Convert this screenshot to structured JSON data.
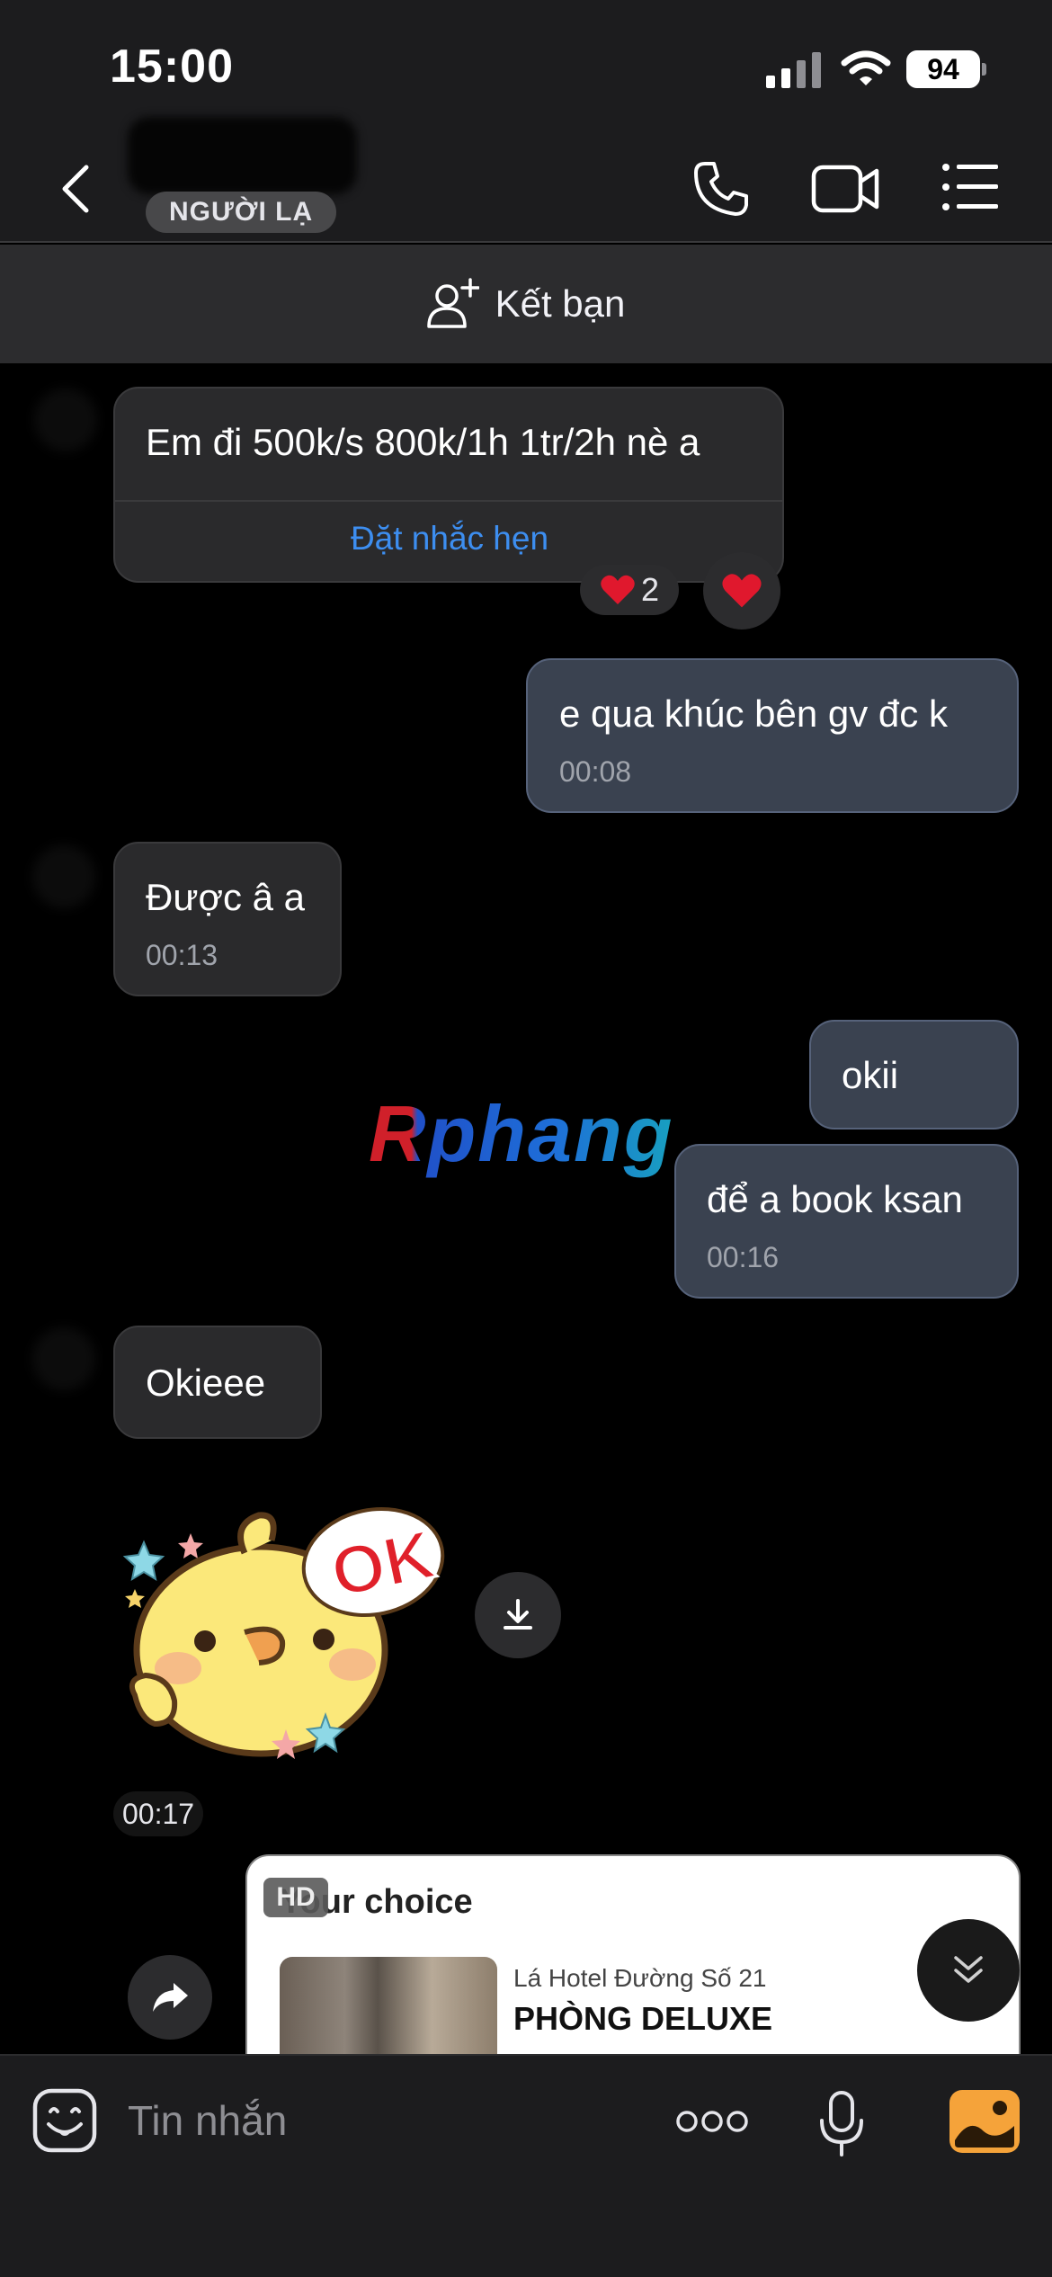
{
  "status_bar": {
    "time": "15:00",
    "battery": "94"
  },
  "header": {
    "stranger_badge": "NGƯỜI LẠ"
  },
  "add_friend": {
    "label": "Kết bạn"
  },
  "messages": [
    {
      "direction": "in",
      "text": "Em đi 500k/s 800k/1h 1tr/2h nè a",
      "action": "Đặt nhắc hẹn",
      "reactions": {
        "emoji": "heart",
        "count": "2"
      }
    },
    {
      "direction": "out",
      "text": "e qua khúc bên gv đc k",
      "time": "00:08"
    },
    {
      "direction": "in",
      "text": "Được â a",
      "time": "00:13"
    },
    {
      "direction": "out",
      "text": "okii"
    },
    {
      "direction": "out",
      "text": "để a book ksan",
      "time": "00:16"
    },
    {
      "direction": "in",
      "text": "Okieee"
    },
    {
      "direction": "in",
      "type": "sticker",
      "sticker_text": "OK",
      "time": "00:17"
    }
  ],
  "watermark": "Rphang",
  "hotel_card": {
    "badge": "HD",
    "title": "Your choice",
    "hotel_name": "Lá Hotel Đường Số 21",
    "room_type": "PHÒNG DELUXE"
  },
  "composer": {
    "placeholder": "Tin nhắn"
  },
  "colors": {
    "incoming_bubble": "#2a2a2c",
    "outgoing_bubble": "#3a4250",
    "link": "#3d8ef0",
    "heart": "#e0182d"
  },
  "icons": [
    "back-icon",
    "call-icon",
    "video-call-icon",
    "menu-icon",
    "add-friend-icon",
    "heart-icon",
    "download-icon",
    "share-icon",
    "chevron-double-down-icon",
    "emoji-icon",
    "more-icon",
    "microphone-icon",
    "gallery-icon"
  ]
}
